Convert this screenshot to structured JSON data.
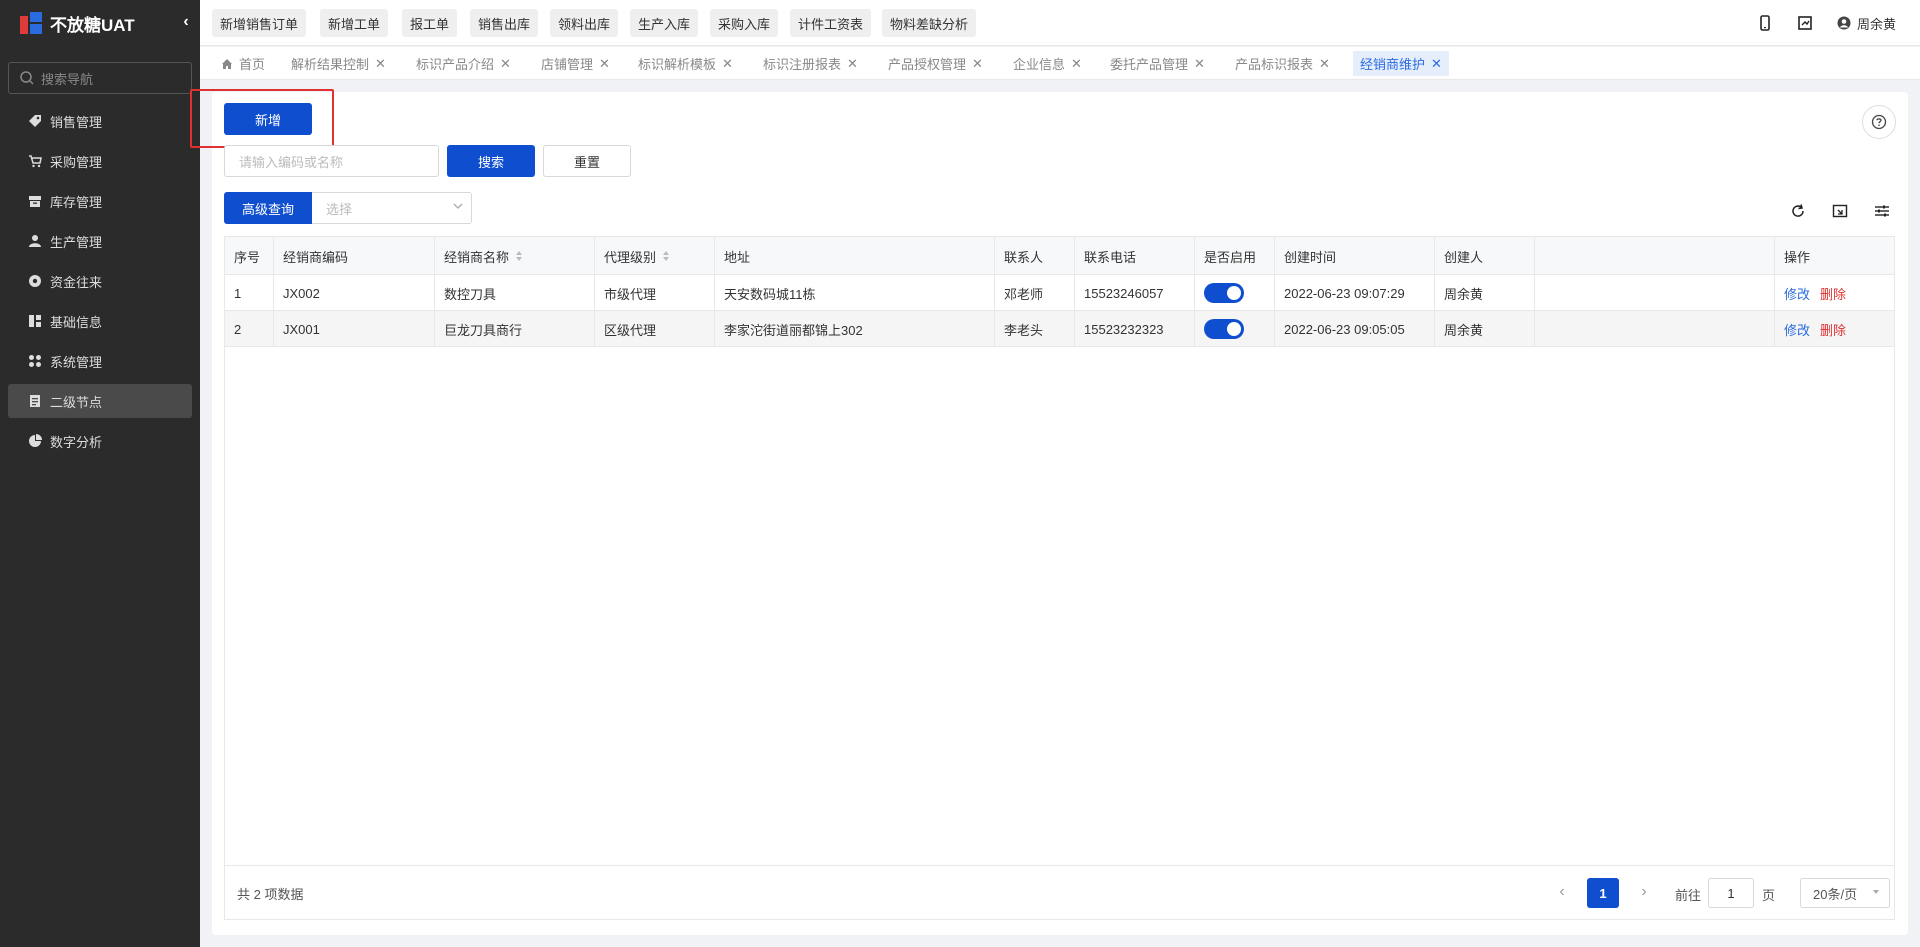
{
  "brand": {
    "name": "不放糖UAT"
  },
  "sidebar": {
    "search_placeholder": "搜索导航",
    "items": [
      {
        "label": "销售管理",
        "icon": "tag-icon"
      },
      {
        "label": "采购管理",
        "icon": "cart-icon"
      },
      {
        "label": "库存管理",
        "icon": "box-icon"
      },
      {
        "label": "生产管理",
        "icon": "worker-icon"
      },
      {
        "label": "资金往来",
        "icon": "coin-icon"
      },
      {
        "label": "基础信息",
        "icon": "grid-icon"
      },
      {
        "label": "系统管理",
        "icon": "apps-icon"
      },
      {
        "label": "二级节点",
        "icon": "doc-icon",
        "active": true
      },
      {
        "label": "数字分析",
        "icon": "pie-icon"
      }
    ]
  },
  "quick_actions": [
    "新增销售订单",
    "新增工单",
    "报工单",
    "销售出库",
    "领料出库",
    "生产入库",
    "采购入库",
    "计件工资表",
    "物料差缺分析"
  ],
  "user": {
    "name": "周余黄"
  },
  "tabs": [
    {
      "label": "首页",
      "home": true
    },
    {
      "label": "解析结果控制"
    },
    {
      "label": "标识产品介绍"
    },
    {
      "label": "店铺管理"
    },
    {
      "label": "标识解析模板"
    },
    {
      "label": "标识注册报表"
    },
    {
      "label": "产品授权管理"
    },
    {
      "label": "企业信息"
    },
    {
      "label": "委托产品管理"
    },
    {
      "label": "产品标识报表"
    },
    {
      "label": "经销商维护",
      "active": true
    }
  ],
  "toolbar": {
    "add_label": "新增",
    "search_placeholder": "请输入编码或名称",
    "search_label": "搜索",
    "reset_label": "重置",
    "advanced_label": "高级查询",
    "select_placeholder": "选择"
  },
  "table": {
    "columns": [
      "序号",
      "经销商编码",
      "经销商名称",
      "代理级别",
      "地址",
      "联系人",
      "联系电话",
      "是否启用",
      "创建时间",
      "创建人",
      "",
      "操作"
    ],
    "rows": [
      {
        "no": "1",
        "code": "JX002",
        "name": "数控刀具",
        "level": "市级代理",
        "address": "天安数码城11栋",
        "contact": "邓老师",
        "phone": "15523246057",
        "enabled": true,
        "created": "2022-06-23 09:07:29",
        "creator": "周余黄"
      },
      {
        "no": "2",
        "code": "JX001",
        "name": "巨龙刀具商行",
        "level": "区级代理",
        "address": "李家沱街道丽都锦上302",
        "contact": "李老头",
        "phone": "15523232323",
        "enabled": true,
        "created": "2022-06-23 09:05:05",
        "creator": "周余黄"
      }
    ],
    "edit_label": "修改",
    "delete_label": "删除"
  },
  "pagination": {
    "total_text": "共 2 项数据",
    "current_page": "1",
    "goto_label": "前往",
    "goto_value": "1",
    "page_unit": "页",
    "page_size": "20条/页"
  },
  "colors": {
    "primary": "#0f4fcf",
    "danger": "#e03030",
    "sidebar_bg": "#2b2b2b"
  }
}
